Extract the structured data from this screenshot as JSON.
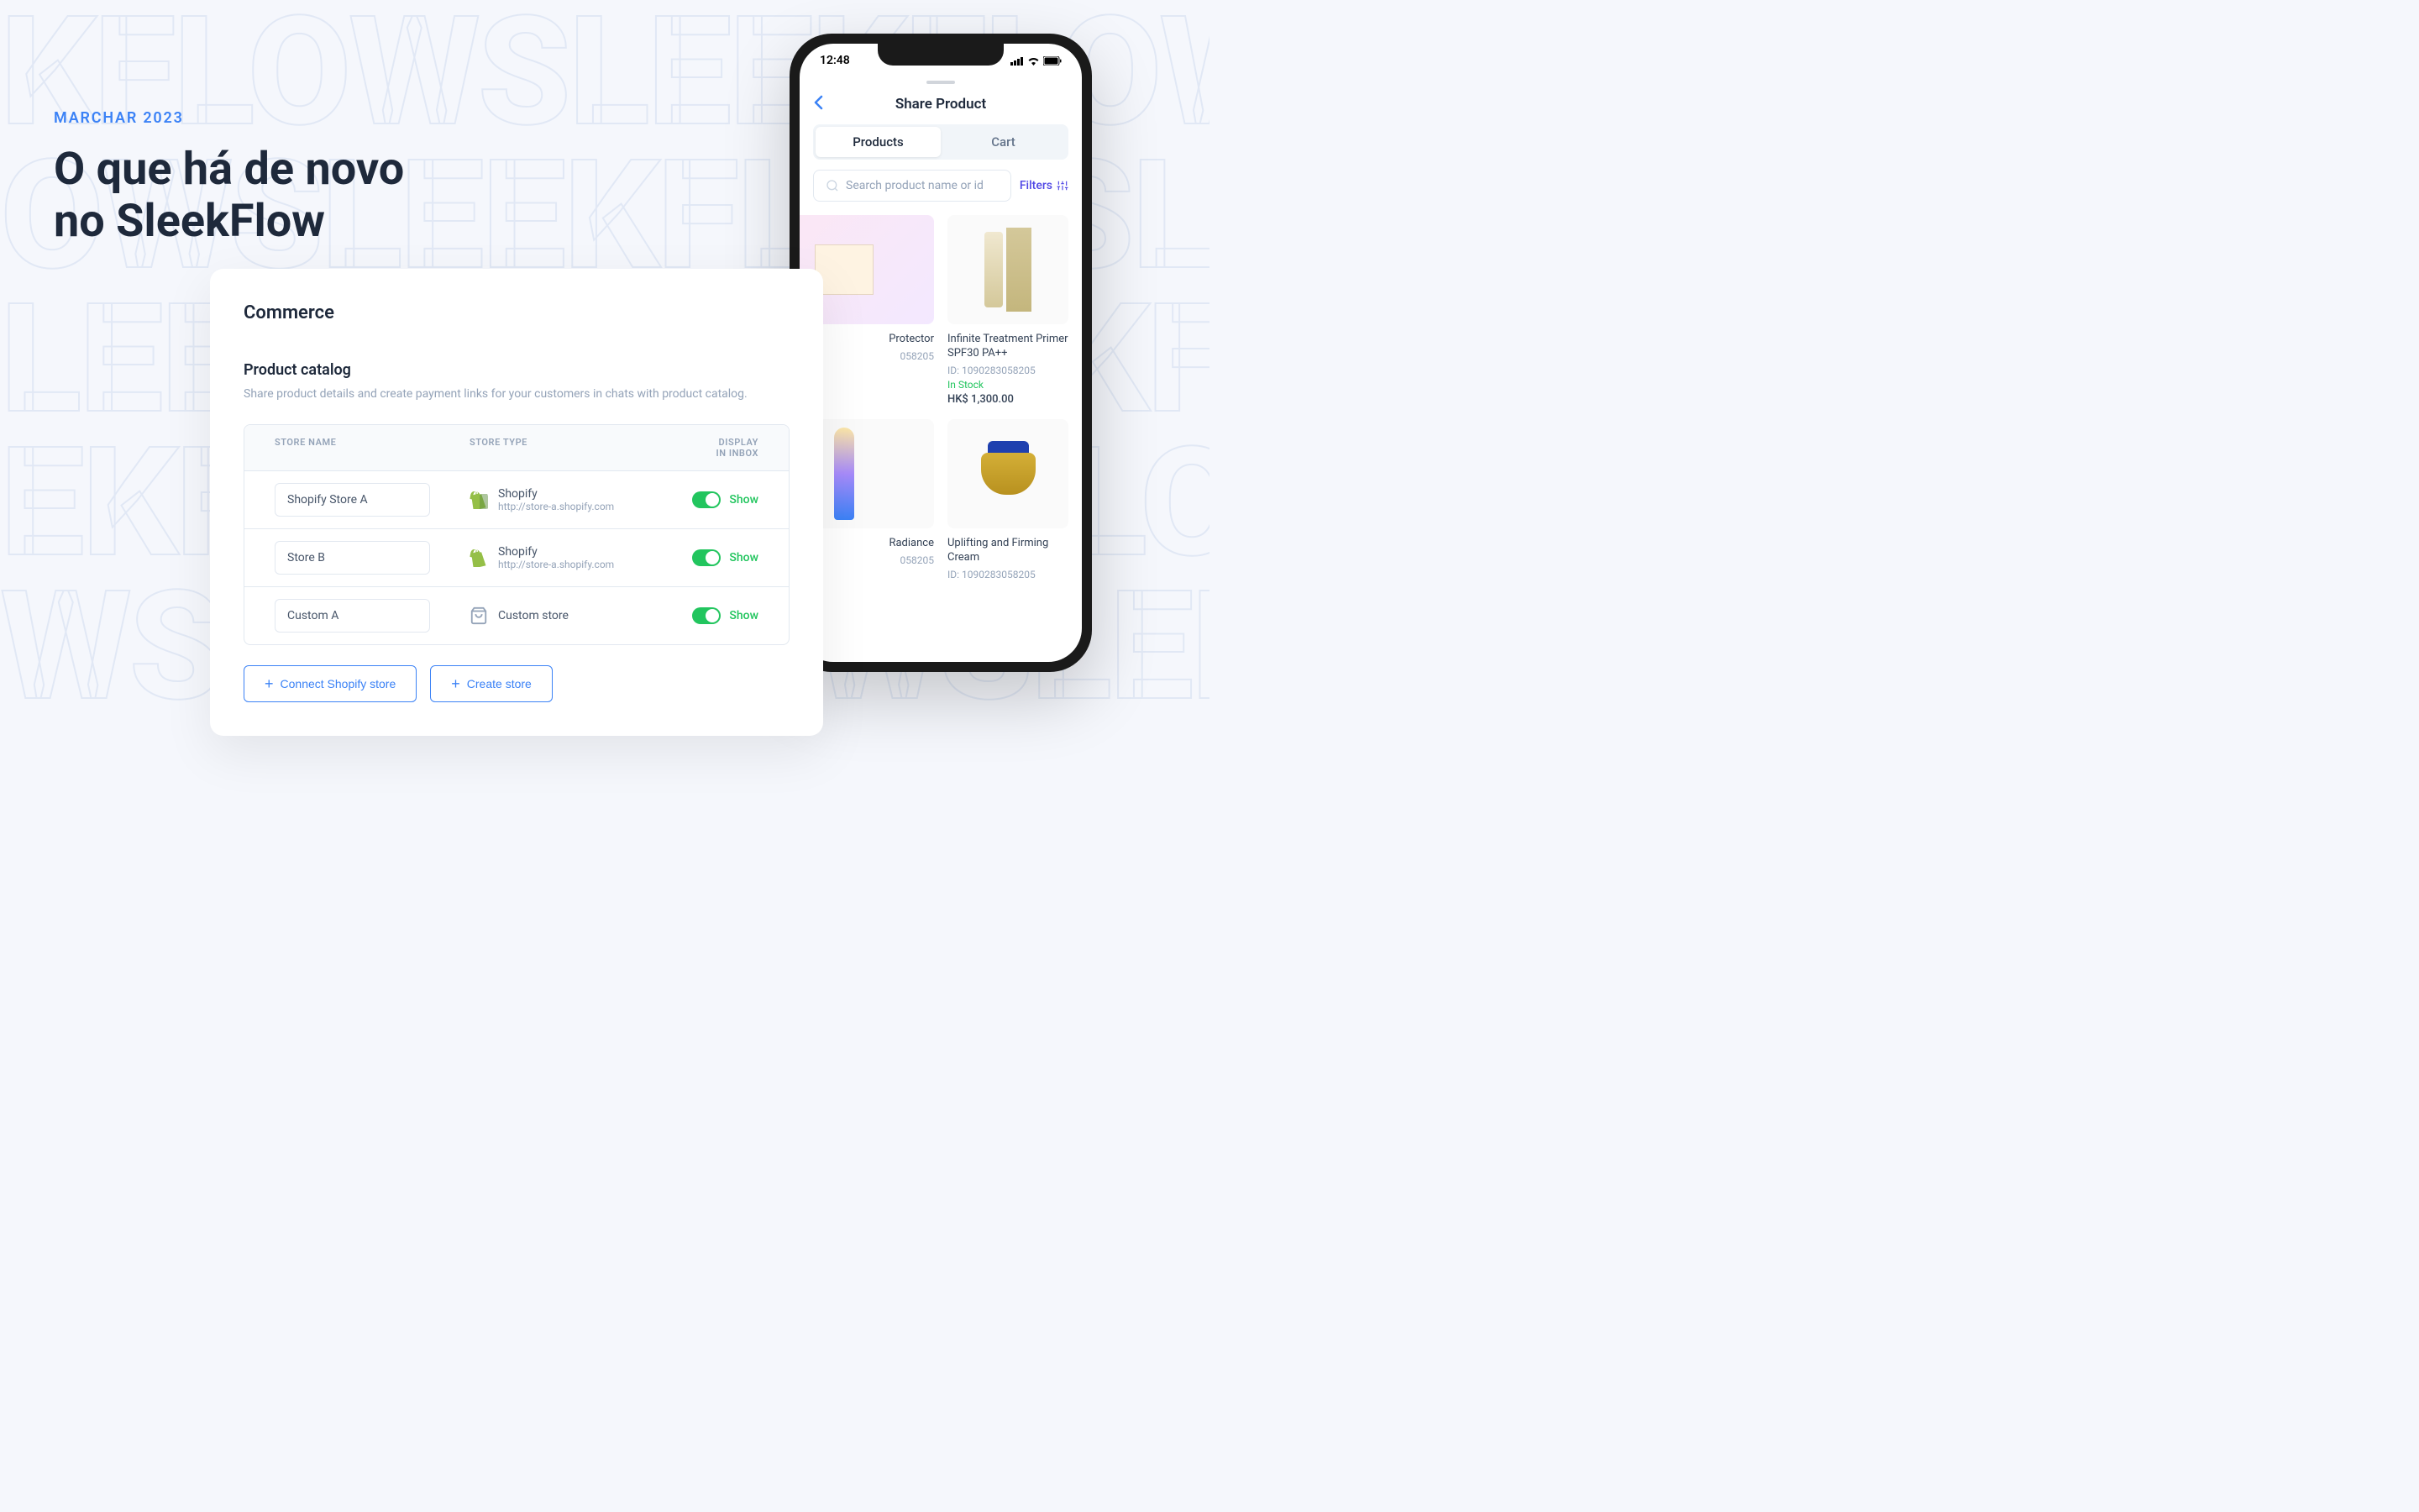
{
  "header": {
    "date_label": "MARCHAR 2023",
    "title_line1": "O que há de novo",
    "title_line2": "no SleekFlow"
  },
  "commerce": {
    "panel_title": "Commerce",
    "section_title": "Product catalog",
    "section_desc": "Share product details and create payment links for your customers in chats with product catalog.",
    "columns": {
      "name": "STORE NAME",
      "type": "STORE TYPE",
      "display": "DISPLAY IN INBOX"
    },
    "rows": [
      {
        "name": "Shopify Store A",
        "type": "Shopify",
        "url": "http://store-a.shopify.com",
        "icon": "shopify",
        "show_label": "Show"
      },
      {
        "name": "Store B",
        "type": "Shopify",
        "url": "http://store-a.shopify.com",
        "icon": "shopify",
        "show_label": "Show"
      },
      {
        "name": "Custom A",
        "type": "Custom store",
        "url": "",
        "icon": "custom",
        "show_label": "Show"
      }
    ],
    "actions": {
      "connect": "Connect Shopify store",
      "create": "Create store"
    }
  },
  "phone": {
    "time": "12:48",
    "title": "Share Product",
    "tabs": {
      "products": "Products",
      "cart": "Cart"
    },
    "search_placeholder": "Search product name or id",
    "filters_label": "Filters",
    "products": [
      {
        "name": "Protector",
        "id": "058205"
      },
      {
        "name": "Infinite Treatment Primer SPF30 PA++",
        "id": "ID: 1090283058205",
        "stock": "In Stock",
        "price": "HK$ 1,300.00"
      },
      {
        "name": "Radiance",
        "id": "058205"
      },
      {
        "name": "Uplifting and Firming Cream",
        "id": "ID: 1090283058205"
      }
    ]
  },
  "bg_word": "SLEEKFLOW"
}
